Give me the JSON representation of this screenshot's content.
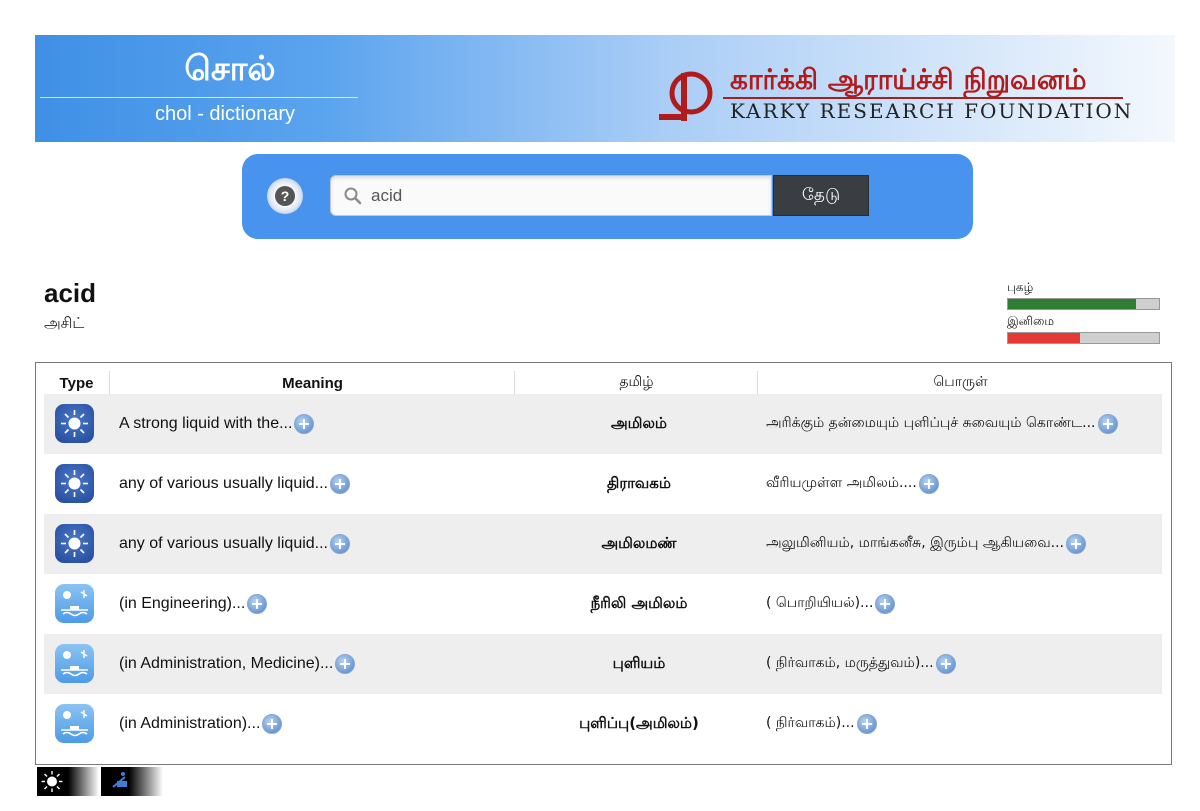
{
  "header": {
    "brand_tamil": "சொல்",
    "brand_subtitle": "chol - dictionary",
    "org_tamil": "கார்க்கி ஆராய்ச்சி நிறுவனம்",
    "org_english": "KARKY RESEARCH FOUNDATION"
  },
  "search": {
    "help_icon": "question-mark-icon",
    "value": "acid",
    "button_label": "தேடு"
  },
  "word": {
    "headword": "acid",
    "transliteration": "அசிட்"
  },
  "meters": [
    {
      "label": "புகழ்",
      "value": 0.85,
      "color": "#2e7d32"
    },
    {
      "label": "இனிமை",
      "value": 0.48,
      "color": "#e53935"
    }
  ],
  "table": {
    "columns": [
      "Type",
      "Meaning",
      "தமிழ்",
      "பொருள்"
    ],
    "rows": [
      {
        "type_icon": "sun-icon",
        "meaning": "A strong liquid with the...",
        "tamil": "அமிலம்",
        "porul": "அரிக்கும் தன்மையும் புளிப்புச் சுவையும் கொண்ட..."
      },
      {
        "type_icon": "sun-icon",
        "meaning": "any of various usually liquid...",
        "tamil": "திராவகம்",
        "porul": "வீரியமுள்ள அமிலம்...."
      },
      {
        "type_icon": "sun-icon",
        "meaning": "any of various usually liquid...",
        "tamil": "அமிலமண்",
        "porul": "அலுமினியம், மாங்கனீசு, இரும்பு ஆகியவை..."
      },
      {
        "type_icon": "engineering-icon",
        "meaning": "(in Engineering)...",
        "tamil": "நீரிலி அமிலம்",
        "porul": "( பொறியியல்)..."
      },
      {
        "type_icon": "engineering-icon",
        "meaning": "(in Administration, Medicine)...",
        "tamil": "புளியம்",
        "porul": "( நிர்வாகம், மருத்துவம்)..."
      },
      {
        "type_icon": "engineering-icon",
        "meaning": "(in Administration)...",
        "tamil": "புளிப்பு(அமிலம்)",
        "porul": "( நிர்வாகம்)..."
      }
    ]
  },
  "legend": [
    "sun-icon",
    "engineering-icon"
  ]
}
